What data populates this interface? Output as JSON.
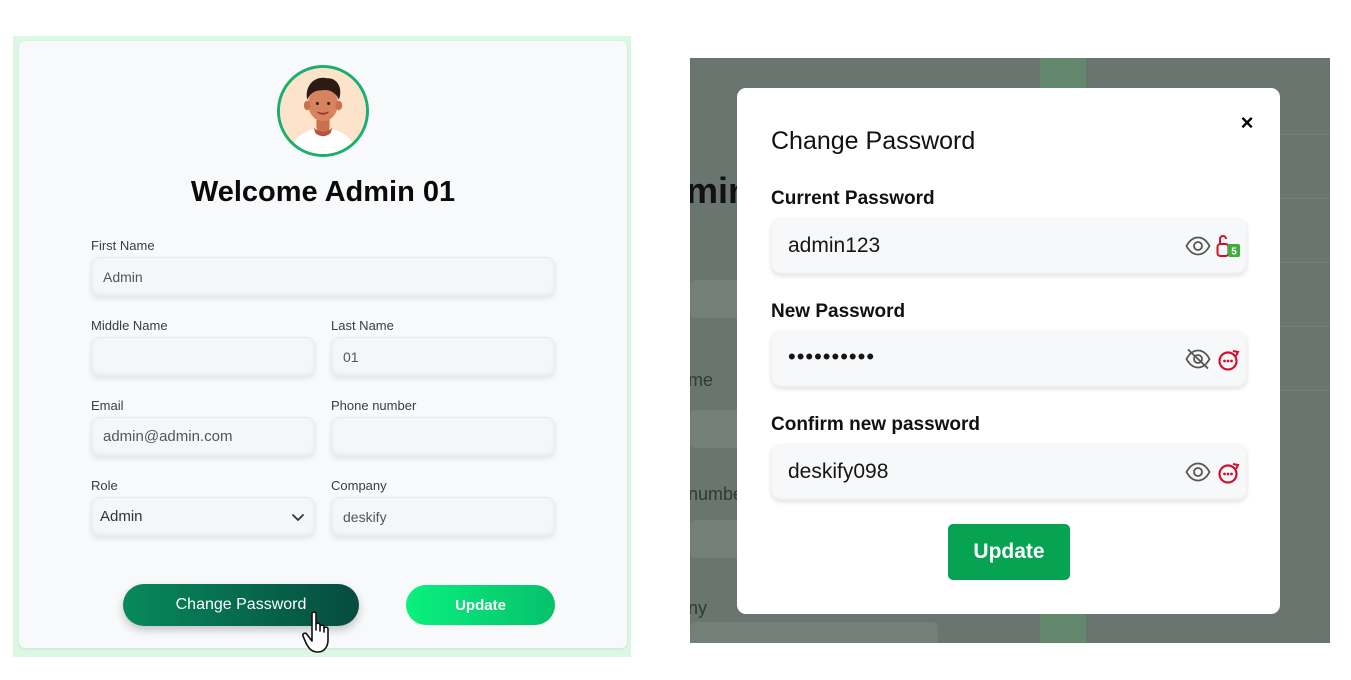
{
  "profile": {
    "welcome": "Welcome Admin 01",
    "fields": {
      "first_name": {
        "label": "First Name",
        "value": "Admin"
      },
      "middle_name": {
        "label": "Middle Name",
        "value": ""
      },
      "last_name": {
        "label": "Last Name",
        "value": "01"
      },
      "email": {
        "label": "Email",
        "value": "admin@admin.com"
      },
      "phone": {
        "label": "Phone number",
        "value": ""
      },
      "role": {
        "label": "Role",
        "value": "Admin"
      },
      "company": {
        "label": "Company",
        "value": "deskify"
      }
    },
    "change_password_label": "Change Password",
    "update_label": "Update"
  },
  "background": {
    "partial_texts": [
      "min",
      "me",
      "numbe",
      "ny"
    ]
  },
  "modal": {
    "title": "Change Password",
    "close_label": "×",
    "current": {
      "label": "Current Password",
      "value": "admin123"
    },
    "new": {
      "label": "New Password",
      "value": "••••••••••"
    },
    "confirm": {
      "label": "Confirm new password",
      "value": "deskify098"
    },
    "update_label": "Update"
  },
  "colors": {
    "accent_dark": "#064b3f",
    "accent_green": "#06a352",
    "accent_bright": "#0af07e",
    "avatar_ring": "#19b06e",
    "extension_red": "#d5102a"
  },
  "icons": [
    "user-avatar",
    "chevron-down-icon",
    "hand-pointer-cursor",
    "close-icon",
    "eye-icon",
    "eye-slash-icon",
    "password-extension-icon"
  ]
}
